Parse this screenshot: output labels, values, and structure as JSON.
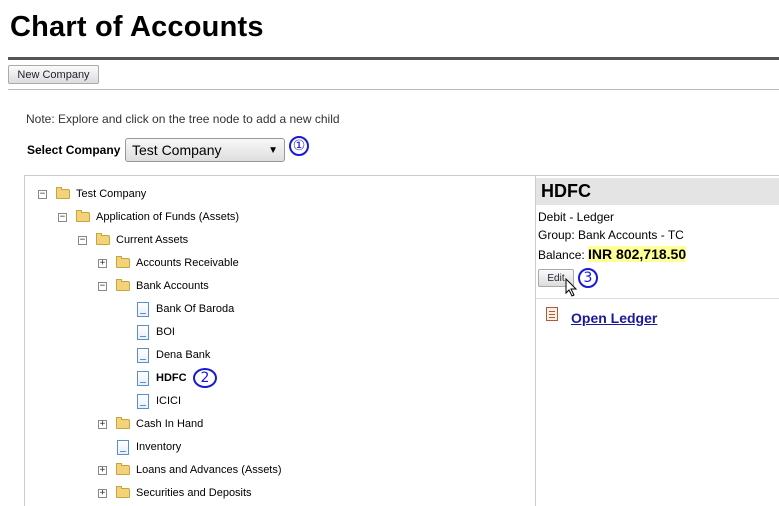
{
  "page": {
    "title": "Chart of Accounts"
  },
  "toolbar": {
    "new_company_label": "New Company"
  },
  "note": "Note: Explore and click on the tree node to add a new child",
  "company_select": {
    "label": "Select Company",
    "value": "Test Company"
  },
  "markers": [
    "①",
    "2",
    "3"
  ],
  "tree": {
    "root": "Test Company",
    "funds": "Application of Funds (Assets)",
    "current_assets": "Current Assets",
    "accounts_receivable": "Accounts Receivable",
    "bank_accounts": "Bank Accounts",
    "bank_of_baroda": "Bank Of Baroda",
    "boi": "BOI",
    "dena_bank": "Dena Bank",
    "hdfc": "HDFC",
    "icici": "ICICI",
    "cash_in_hand": "Cash In Hand",
    "inventory": "Inventory",
    "loans": "Loans and Advances (Assets)",
    "securities": "Securities and Deposits"
  },
  "detail": {
    "title": "HDFC",
    "type": "Debit - Ledger",
    "group": "Group: Bank Accounts - TC",
    "balance_label": "Balance:",
    "balance_value": "INR 802,718.50",
    "edit_label": "Edit",
    "open_ledger_label": "Open Ledger"
  },
  "colors": {
    "marker": "#1a1ad6",
    "balance_highlight": "#ffff99",
    "link": "#1a1a99"
  }
}
